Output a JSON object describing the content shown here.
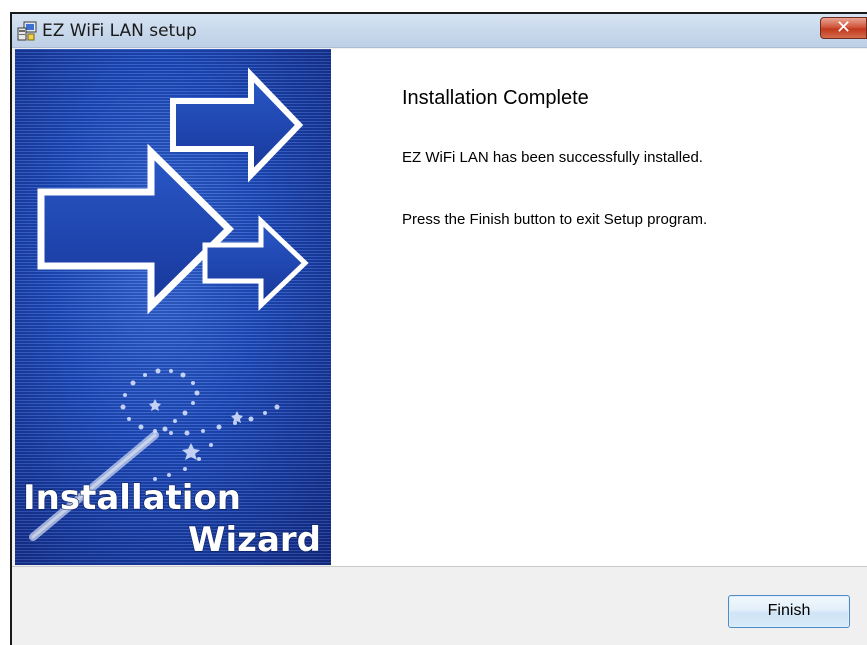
{
  "window": {
    "title": "EZ WiFi LAN setup",
    "close_label": "✕",
    "icon": "installer-icon"
  },
  "banner": {
    "line1": "Installation",
    "line2": "Wizard",
    "icon": "arrows-and-wand-graphic"
  },
  "content": {
    "heading": "Installation Complete",
    "message1": "EZ WiFi LAN has been successfully installed.",
    "message2": "Press the Finish button to exit Setup program."
  },
  "footer": {
    "finish_label": "Finish"
  },
  "colors": {
    "banner_blue": "#1c48b4",
    "titlebar": "#c9d9ec",
    "close_red": "#c2391c",
    "button_border": "#4f8bc8"
  }
}
